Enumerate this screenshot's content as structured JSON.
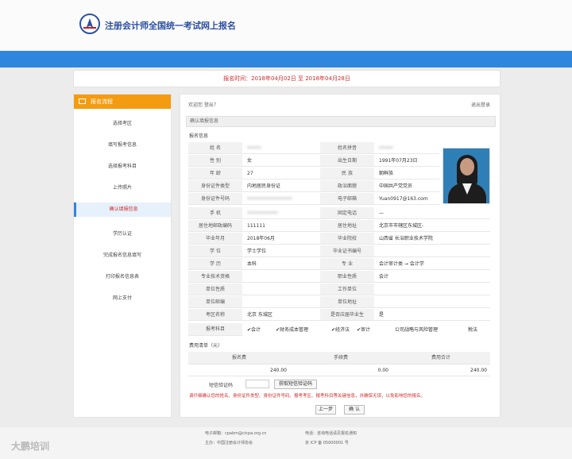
{
  "header": {
    "title": "注册会计师全国统一考试网上报名"
  },
  "date_notice": "报名时间：2018年04月02日 至 2018年04月28日",
  "sidebar": {
    "title": "报名流程",
    "items": [
      {
        "label": "选择考区"
      },
      {
        "label": "填写报考信息"
      },
      {
        "label": "选择报考科目"
      },
      {
        "label": "上传照片"
      },
      {
        "label": "确认填报信息",
        "active": true
      },
      {
        "label": "学历认证"
      },
      {
        "label": "完成报名信息填写"
      },
      {
        "label": "打印报名信息表"
      },
      {
        "label": "网上支付"
      }
    ]
  },
  "main": {
    "welcome": "欢迎您 登出？",
    "logout": "退出登录",
    "panel_title": "确认填报信息",
    "section_info": "报名信息",
    "form": {
      "name_label": "姓 名",
      "name_value": "•••••",
      "pinyin_label": "姓名拼音",
      "pinyin_value": "•••••",
      "gender_label": "性 别",
      "gender_value": "女",
      "birth_label": "出生日期",
      "birth_value": "1991年07月23日",
      "age_label": "年 龄",
      "age_value": "27",
      "ethnic_label": "民 族",
      "ethnic_value": "朝鲜族",
      "idtype_label": "身份证件类型",
      "idtype_value": "内地居民身份证",
      "politic_label": "政治面貌",
      "politic_value": "中国共产党党员",
      "idno_label": "身份证件号码",
      "idno_value": "••••••••••••••••",
      "email_label": "电子邮箱",
      "email_value": "Yuan0917@163.com",
      "mobile_label": "手 机",
      "mobile_value": "•••••••••••",
      "phone_label": "固定电话",
      "phone_value": "—",
      "post_label": "居住地邮政编码",
      "post_value": "111111",
      "address_label": "居住地址",
      "address_value": "北京市市辖区东城区-",
      "grad_time_label": "毕业年月",
      "grad_time_value": "2018年06月",
      "school_label": "毕业院校",
      "school_value": "山西省 长治职业技术学院",
      "degree_label": "学 位",
      "degree_value": "学士学位",
      "cert_label": "毕业证书编号",
      "cert_value": "",
      "edu_label": "学 历",
      "edu_value": "本科",
      "major_label": "专 业",
      "major_value": "会计审计类 → 会计学",
      "title_label": "专业技术资格",
      "title_value": "",
      "job_label": "职业性质",
      "job_value": "会计",
      "unit_label": "单位性质",
      "unit_value": "",
      "work_label": "工作单位",
      "work_value": "",
      "unitpost_label": "单位邮编",
      "unitpost_value": "",
      "unitaddr_label": "单位地址",
      "unitaddr_value": "",
      "area_label": "考区名称",
      "area_value": "北京 东城区",
      "grad_label": "是否应届毕业生",
      "grad_value": "是"
    },
    "subjects": {
      "label": "报考科目",
      "items": [
        "✔会计",
        "✔财务成本管理",
        "✔经济法",
        "✔审计",
        "公司战略与风险管理",
        "税法"
      ]
    },
    "fee": {
      "section": "费用清单（元）",
      "headers": [
        "报名费",
        "手续费",
        "费用合计"
      ],
      "values": [
        "240.00",
        "0.00",
        "240.00"
      ]
    },
    "sms": {
      "label": "短信验证码",
      "button": "获取短信验证码"
    },
    "warning": "请仔细确认您的姓名、身份证件类型、身份证件号码、报考考区、报考科目等关键信息，并确保无误，以免影响您的报名。",
    "buttons": {
      "prev": "上一步",
      "confirm": "确 认"
    }
  },
  "footer": {
    "email": "电子邮箱：cpabm@cicpa.org.cn",
    "phone": "电话：咨询电话请见报名通知",
    "host": "主办：中国注册会计师协会",
    "icp": "京 ICP 备 05000001 号"
  },
  "watermark": "大鹏培训"
}
